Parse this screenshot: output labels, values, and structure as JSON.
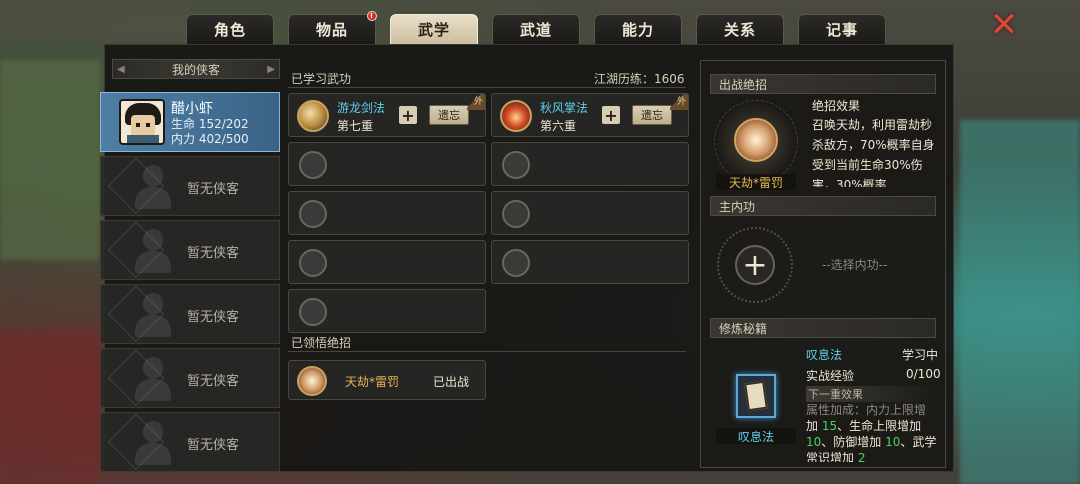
{
  "tabs": [
    {
      "label": "角色",
      "active": false
    },
    {
      "label": "物品",
      "active": false,
      "has_notice": true,
      "notice": "!"
    },
    {
      "label": "武学",
      "active": true
    },
    {
      "label": "武道",
      "active": false
    },
    {
      "label": "能力",
      "active": false
    },
    {
      "label": "关系",
      "active": false
    },
    {
      "label": "记事",
      "active": false
    }
  ],
  "close_icon": "close-icon",
  "heroes": {
    "header": "我的侠客",
    "selected": {
      "name": "醋小虾",
      "hp_label": "生命",
      "hp": "152/202",
      "mp_label": "内力",
      "mp": "402/500"
    },
    "empty_label": "暂无侠客",
    "empty_slots": 5
  },
  "learned": {
    "title": "已学习武功",
    "experience": "江湖历练：1606",
    "skills": [
      {
        "name": "游龙剑法",
        "level": "第七重",
        "forget": "遗忘",
        "tag": "外",
        "icon": "sword-icon"
      },
      {
        "name": "秋风掌法",
        "level": "第六重",
        "forget": "遗忘",
        "tag": "外",
        "icon": "palm-icon"
      }
    ]
  },
  "ultimates": {
    "title": "已领悟绝招",
    "items": [
      {
        "name": "天劫*雷罚",
        "status": "已出战",
        "icon": "thunder-icon"
      }
    ]
  },
  "battle_ult": {
    "title": "出战绝招",
    "name": "天劫*雷罚",
    "effect_title": "绝招效果",
    "effect_text": "召唤天劫，利用雷劫秒杀敌方，70%概率自身受到当前生命30%伤害，30%概率"
  },
  "inner": {
    "title": "主内功",
    "placeholder": "--选择内功--",
    "add_label": "+"
  },
  "cultivation": {
    "title": "修炼秘籍",
    "book_name": "叹息法",
    "status": "学习中",
    "exp_label": "实战经验",
    "exp_value": "0/100",
    "next_label": "下一重效果",
    "next_cut": "属性加成：内力上限增",
    "next_parts": [
      "加",
      "15",
      "、生命上限增加",
      "10",
      "、防御增加",
      "10",
      "、武学常识增加",
      "2"
    ]
  }
}
